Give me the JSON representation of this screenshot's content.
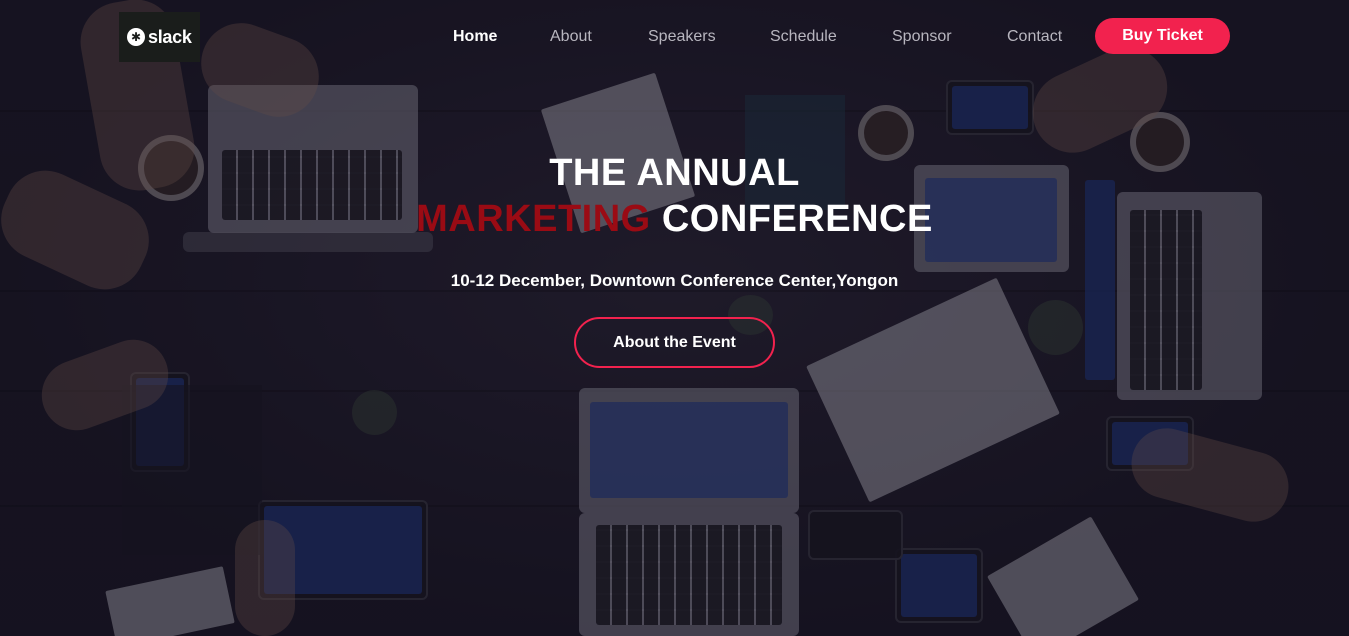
{
  "brand": {
    "logo_text": "slack",
    "logo_glyph": "✱"
  },
  "nav": {
    "items": [
      {
        "label": "Home",
        "active": true
      },
      {
        "label": "About",
        "active": false
      },
      {
        "label": "Speakers",
        "active": false
      },
      {
        "label": "Schedule",
        "active": false
      },
      {
        "label": "Sponsor",
        "active": false
      },
      {
        "label": "Contact",
        "active": false
      }
    ],
    "cta_label": "Buy Ticket"
  },
  "hero": {
    "title_line1": "THE ANNUAL",
    "title_accent": "MARKETING",
    "title_rest": "CONFERENCE",
    "subtitle": "10-12 December, Downtown Conference Center,Yongon",
    "button_label": "About the Event"
  },
  "colors": {
    "accent": "#f2224e",
    "title_accent": "#9a0b14",
    "nav_inactive": "#b8b6bf",
    "background": "#221e2c"
  }
}
